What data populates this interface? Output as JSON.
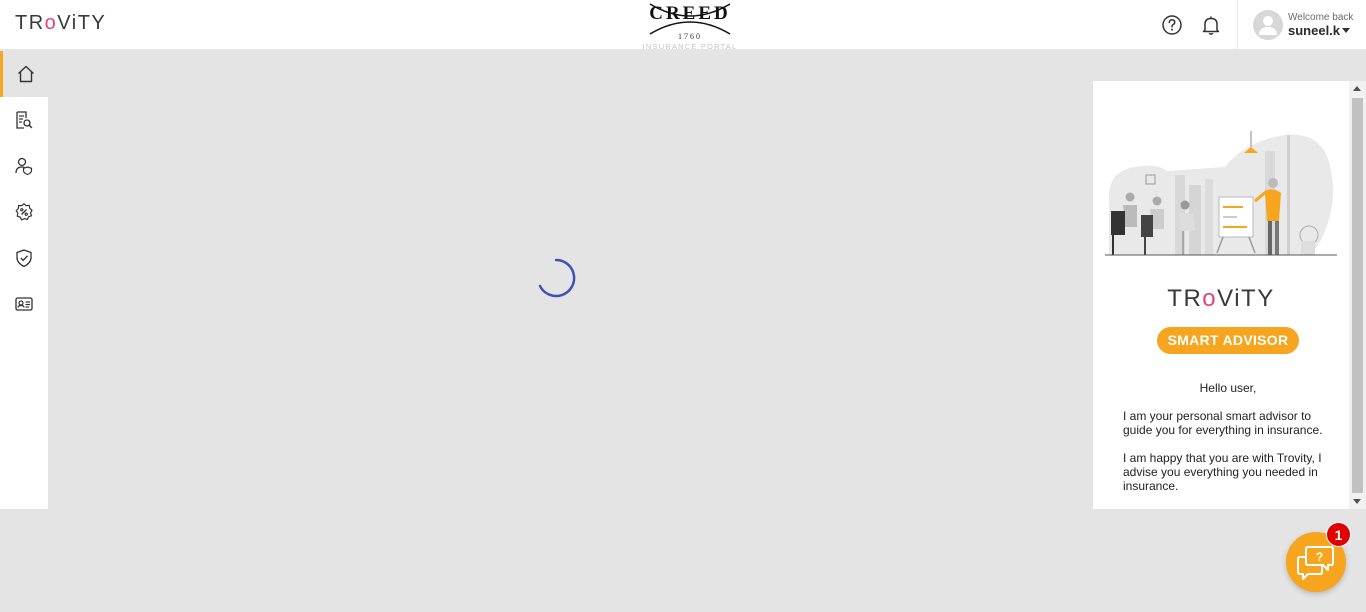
{
  "header": {
    "brand": {
      "pre": "TR",
      "mid": "o",
      "post": "ViTY"
    },
    "center_logo": {
      "word": "CREED",
      "year": "1760",
      "subtitle": "INSURANCE PORTAL"
    },
    "help_icon": "question-circle-icon",
    "notification_icon": "bell-icon",
    "user": {
      "welcome": "Welcome back",
      "name": "suneel.k"
    }
  },
  "sidebar": {
    "items": [
      {
        "icon": "home-icon",
        "active": true
      },
      {
        "icon": "policy-search-icon",
        "active": false
      },
      {
        "icon": "user-shield-icon",
        "active": false
      },
      {
        "icon": "percent-badge-icon",
        "active": false
      },
      {
        "icon": "shield-check-icon",
        "active": false
      },
      {
        "icon": "id-card-icon",
        "active": false
      }
    ]
  },
  "main": {
    "loading": true
  },
  "advisor": {
    "brand": {
      "pre": "TR",
      "mid": "o",
      "post": "ViTY"
    },
    "badge": "SMART ADVISOR",
    "greeting": "Hello user,",
    "paragraphs": [
      "I am your personal smart advisor to guide you for everything in insurance.",
      "I am happy that you are with Trovity, I advise you everything you needed in insurance."
    ]
  },
  "chat": {
    "icon": "chat-help-icon",
    "badge_count": "1"
  },
  "colors": {
    "accent": "#f7a51e",
    "spinner": "#3f51b5",
    "badge_red": "#e00000",
    "background": "#e4e4e4"
  }
}
